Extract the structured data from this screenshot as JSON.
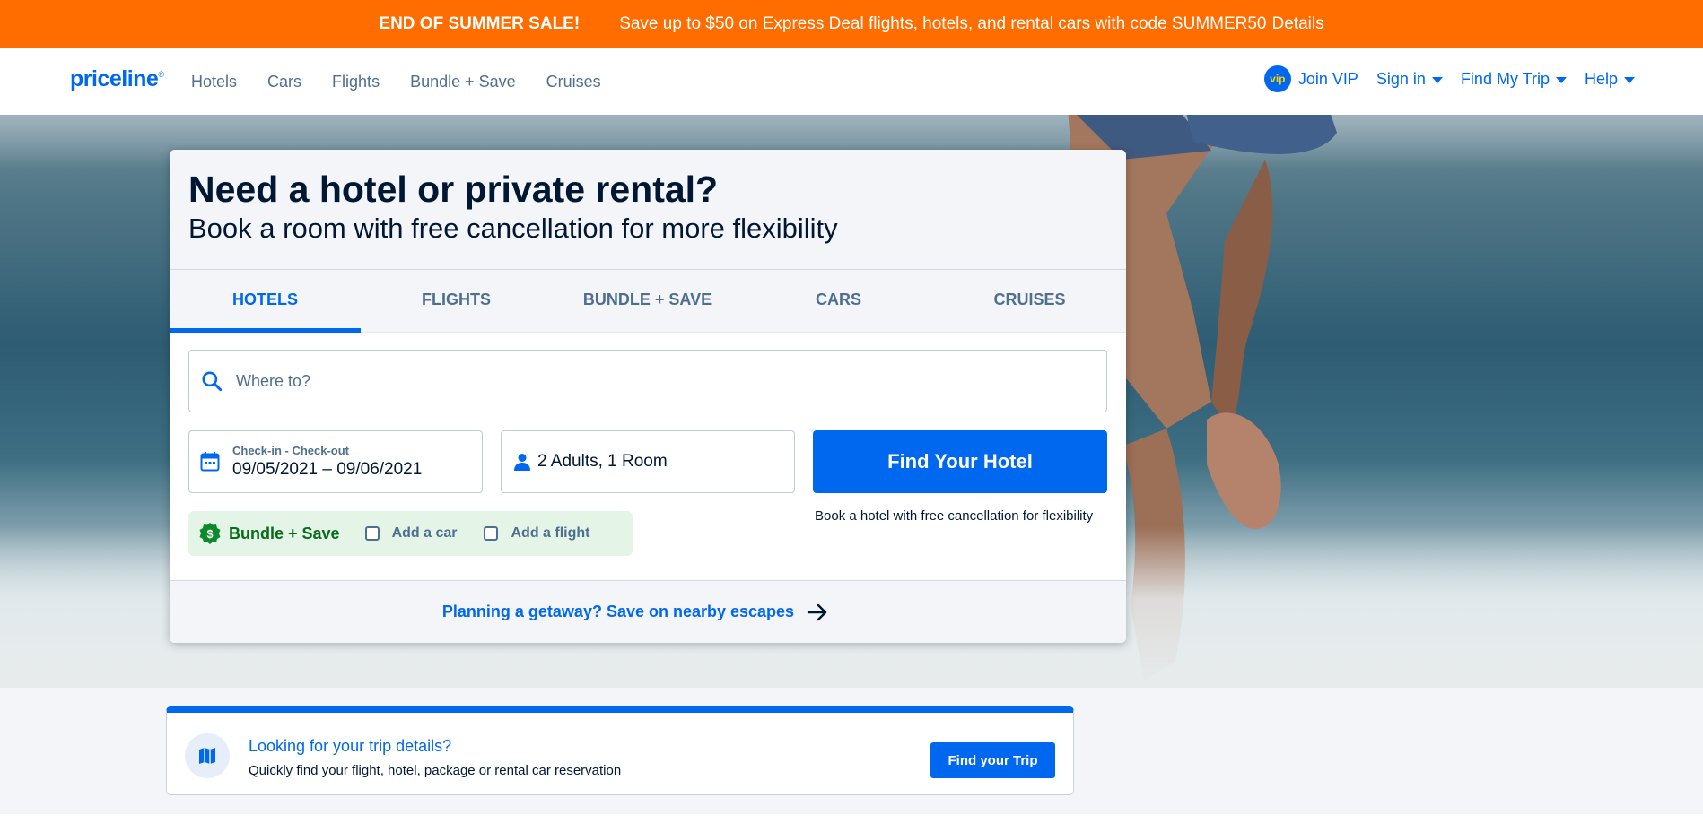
{
  "promo": {
    "sale": "END OF SUMMER SALE!",
    "message": "Save up to $50 on Express Deal flights, hotels, and rental cars with code SUMMER50",
    "details": "Details"
  },
  "nav": {
    "logo": "priceline",
    "logo_mark": "®",
    "links": [
      "Hotels",
      "Cars",
      "Flights",
      "Bundle + Save",
      "Cruises"
    ],
    "vip_badge": "vip",
    "join_vip": "Join VIP",
    "sign_in": "Sign in",
    "find_my_trip": "Find My Trip",
    "help": "Help"
  },
  "card": {
    "title": "Need a hotel or private rental?",
    "subtitle": "Book a room with free cancellation for more flexibility",
    "tabs": [
      "HOTELS",
      "FLIGHTS",
      "BUNDLE + SAVE",
      "CARS",
      "CRUISES"
    ],
    "active_tab": "HOTELS",
    "where_placeholder": "Where to?",
    "dates_label": "Check-in - Check-out",
    "dates_value": "09/05/2021 – 09/06/2021",
    "guests_value": "2 Adults, 1 Room",
    "find_button": "Find Your Hotel",
    "find_note": "Book a hotel with free cancellation for flexibility",
    "bundle_title": "Bundle + Save",
    "add_car": "Add a car",
    "add_flight": "Add a flight",
    "footer_link": "Planning a getaway? Save on nearby escapes"
  },
  "trip": {
    "title": "Looking for your trip details?",
    "desc": "Quickly find your flight, hotel, package or rental car reservation",
    "button": "Find your Trip"
  },
  "colors": {
    "promo_bg": "#ff6d00",
    "brand_blue": "#0068ef",
    "bundle_green": "#0a6b1c"
  }
}
